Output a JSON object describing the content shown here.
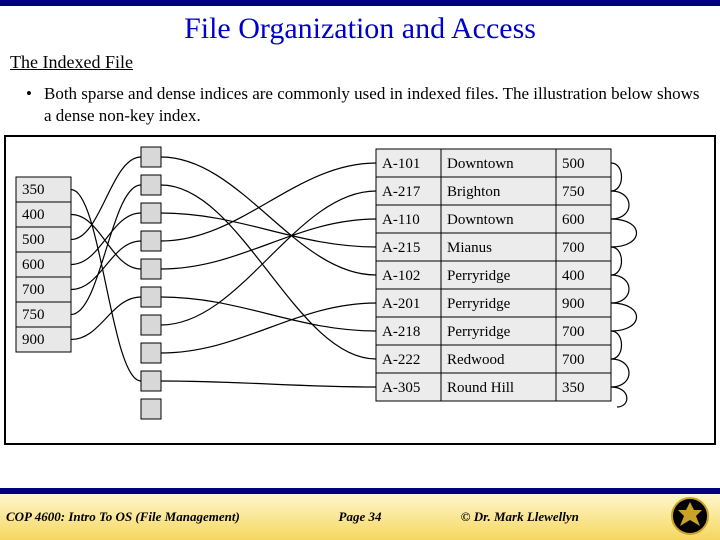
{
  "title": "File Organization and Access",
  "subtitle": "The Indexed File",
  "bullet": "Both sparse and dense indices are commonly used in indexed files. The illustration below shows a dense non-key index.",
  "index_values": [
    "350",
    "400",
    "500",
    "600",
    "700",
    "750",
    "900"
  ],
  "records": [
    {
      "acct": "A-101",
      "branch": "Downtown",
      "bal": "500"
    },
    {
      "acct": "A-217",
      "branch": "Brighton",
      "bal": "750"
    },
    {
      "acct": "A-110",
      "branch": "Downtown",
      "bal": "600"
    },
    {
      "acct": "A-215",
      "branch": "Mianus",
      "bal": "700"
    },
    {
      "acct": "A-102",
      "branch": "Perryridge",
      "bal": "400"
    },
    {
      "acct": "A-201",
      "branch": "Perryridge",
      "bal": "900"
    },
    {
      "acct": "A-218",
      "branch": "Perryridge",
      "bal": "700"
    },
    {
      "acct": "A-222",
      "branch": "Redwood",
      "bal": "700"
    },
    {
      "acct": "A-305",
      "branch": "Round Hill",
      "bal": "350"
    }
  ],
  "footer": {
    "course": "COP 4600: Intro To OS  (File Management)",
    "page": "Page 34",
    "credit": "© Dr. Mark Llewellyn"
  }
}
